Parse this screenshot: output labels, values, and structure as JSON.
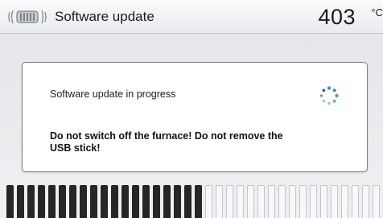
{
  "header": {
    "icon": "furnace-icon",
    "title": "Software update",
    "temperature": "403",
    "unit": "°C"
  },
  "dialog": {
    "status_text": "Software update in progress",
    "spinner_icon": "loading-spinner-icon",
    "warning_text": "Do not switch off the furnace! Do not remove the USB stick!"
  },
  "progress": {
    "total_segments": 36,
    "filled_segments": 19,
    "fraction": 0.53,
    "filled_color": "#262629",
    "empty_color": "#f7f8f9"
  }
}
